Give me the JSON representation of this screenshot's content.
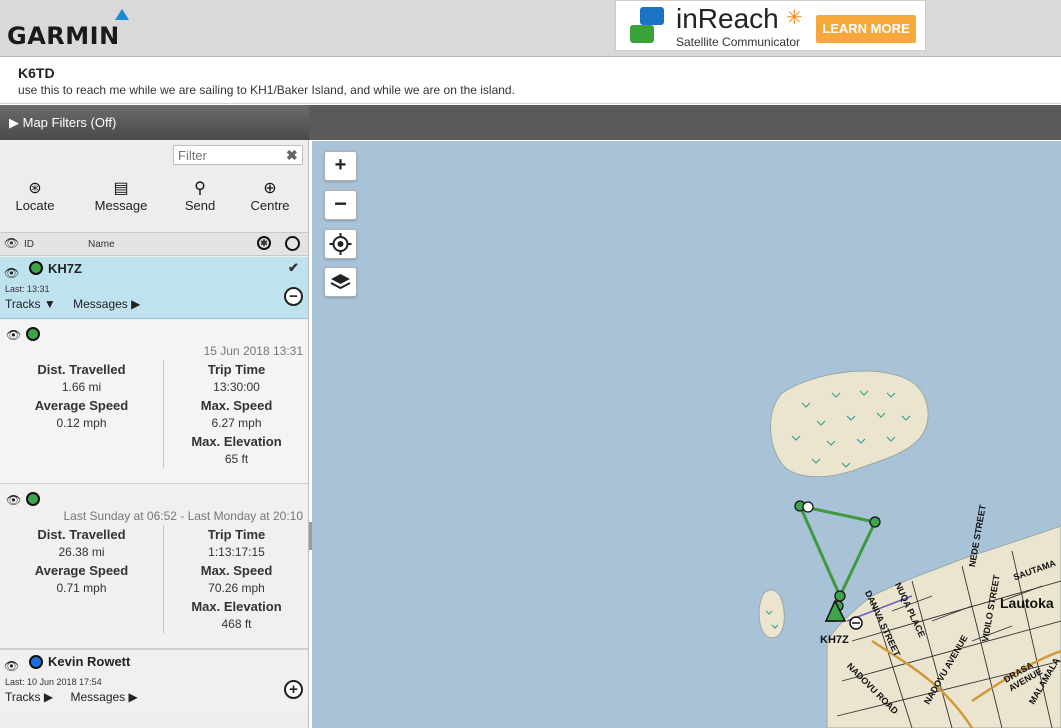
{
  "header": {
    "brand": "GARMIN",
    "ad": {
      "brand": "inReach",
      "subtitle": "Satellite Communicator",
      "cta": "LEARN MORE"
    }
  },
  "info": {
    "title": "K6TD",
    "description": "use this to reach me while we are sailing to KH1/Baker Island, and while we are on the island."
  },
  "map_filters": {
    "label": "▶ Map Filters (Off)"
  },
  "sidebar": {
    "filter_placeholder": "Filter",
    "actions": [
      {
        "label": "Locate",
        "icon": "locate-icon"
      },
      {
        "label": "Message",
        "icon": "message-icon"
      },
      {
        "label": "Send",
        "icon": "send-pin-icon"
      },
      {
        "label": "Centre",
        "icon": "centre-icon"
      }
    ],
    "list_header": {
      "id": "ID",
      "name": "Name"
    },
    "devices": [
      {
        "name": "KH7Z",
        "last": "Last: 13:31",
        "tracks": "Tracks ▼",
        "messages": "Messages ▶",
        "color": "#3fa34a",
        "selected": true
      },
      {
        "name": "Kevin Rowett",
        "last": "Last: 10 Jun 2018 17:54",
        "tracks": "Tracks ▶",
        "messages": "Messages ▶",
        "color": "#1a6ee0",
        "selected": false
      }
    ],
    "tracks": [
      {
        "date": "15 Jun 2018 13:31",
        "dist_label": "Dist. Travelled",
        "dist": "1.66 mi",
        "trip_label": "Trip Time",
        "trip": "13:30:00",
        "avg_label": "Average Speed",
        "avg": "0.12 mph",
        "max_label": "Max. Speed",
        "max": "6.27 mph",
        "elev_label": "Max. Elevation",
        "elev": "65 ft"
      },
      {
        "date": "Last Sunday at 06:52 - Last Monday at 20:10",
        "dist_label": "Dist. Travelled",
        "dist": "26.38 mi",
        "trip_label": "Trip Time",
        "trip": "1:13:17:15",
        "avg_label": "Average Speed",
        "avg": "0.71 mph",
        "max_label": "Max. Speed",
        "max": "70.26 mph",
        "elev_label": "Max. Elevation",
        "elev": "468 ft"
      }
    ]
  },
  "map": {
    "controls": {
      "zoom_in": "+",
      "zoom_out": "−"
    },
    "labels": {
      "marker": "KH7Z",
      "city": "Lautoka",
      "streets": [
        "DANIVA STREET",
        "NUQA PLACE",
        "NEDE STREET",
        "NADOVU ROAD",
        "VIDILO STREET",
        "DRASA AVENUE",
        "SAUTAMA",
        "MALAMALA",
        "NADOVU AVENUE"
      ]
    },
    "colors": {
      "water": "#a8c2d8",
      "land": "#ebe4cf",
      "track": "#3f9a3f"
    }
  }
}
